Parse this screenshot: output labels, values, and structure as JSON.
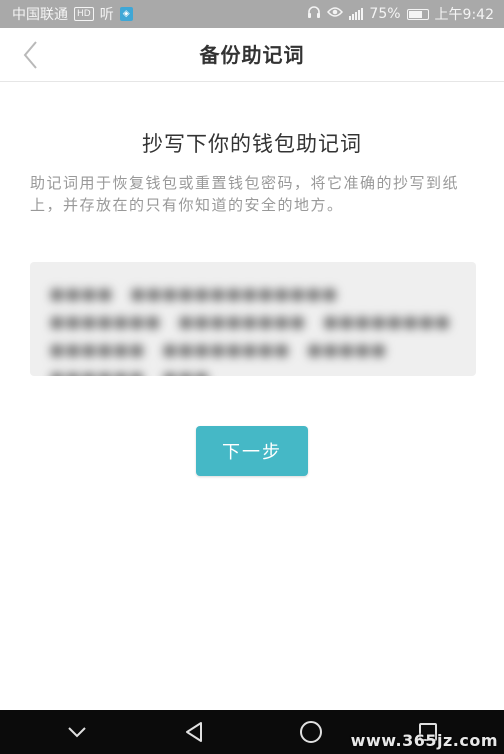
{
  "status_bar": {
    "carrier": "中国联通",
    "hd_badge": "HD",
    "listen_text": "听",
    "battery_percent": "75%",
    "battery_level": 0.75,
    "time": "上午9:42",
    "icons": [
      "carrier-hd-icon",
      "app-notification-icon",
      "headphone-icon",
      "eye-icon",
      "signal-icon",
      "battery-icon"
    ]
  },
  "header": {
    "title": "备份助记词",
    "back_icon": "chevron-left-icon"
  },
  "main": {
    "heading": "抄写下你的钱包助记词",
    "description": "助记词用于恢复钱包或重置钱包密码，将它准确的抄写到纸上，并存放在的只有你知道的安全的地方。",
    "mnemonic_blurred": "●●●● ●●●●●●●●●●●●● ●●●●●●● ●●●●●●●● ●●●●●●●● ●●●●●● ●●●●●●●● ●●●●● ●●●●●● ●●●"
  },
  "actions": {
    "next_label": "下一步",
    "accent_color": "#45b8c6"
  },
  "system_nav": {
    "icons": [
      "nav-down-icon",
      "nav-back-icon",
      "nav-home-icon",
      "nav-recent-icon"
    ]
  },
  "watermark": "www.365jz.com"
}
